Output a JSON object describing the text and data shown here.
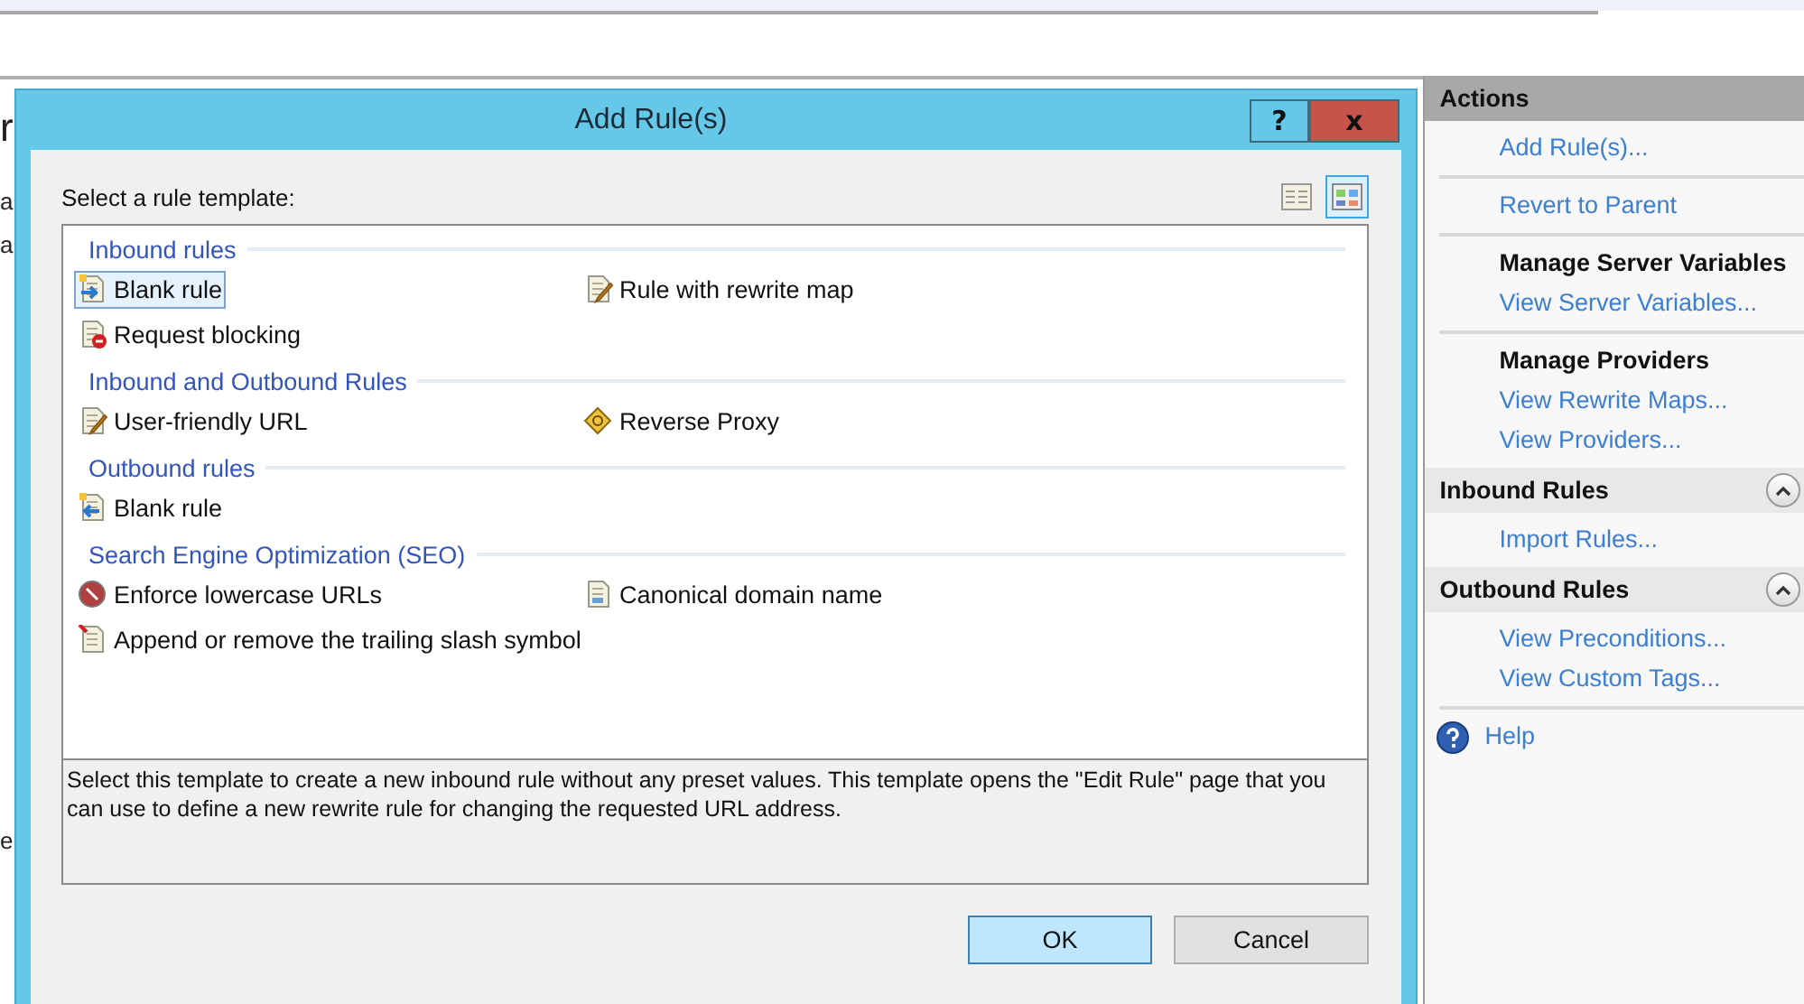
{
  "background": {
    "fragments": [
      {
        "text": "r",
        "kind": "title"
      },
      {
        "text": "a",
        "kind": "line"
      },
      {
        "text": "a",
        "kind": "line"
      },
      {
        "text": "e",
        "kind": "field"
      }
    ]
  },
  "dialog": {
    "title": "Add Rule(s)",
    "help_button": "?",
    "close_button": "x",
    "prompt": "Select a rule template:",
    "views": [
      {
        "kind": "list",
        "selected": false
      },
      {
        "kind": "tiles",
        "selected": true
      }
    ],
    "groups": [
      {
        "title": "Inbound rules",
        "items": [
          {
            "label": "Blank rule",
            "kind": "arrow-in",
            "selected": true
          },
          {
            "label": "Rule with rewrite map",
            "kind": "edit",
            "selected": false
          },
          {
            "label": "Request blocking",
            "kind": "block",
            "selected": false
          }
        ]
      },
      {
        "title": "Inbound and Outbound Rules",
        "items": [
          {
            "label": "User-friendly URL",
            "kind": "edit",
            "selected": false
          },
          {
            "label": "Reverse Proxy",
            "kind": "proxy",
            "selected": false
          }
        ]
      },
      {
        "title": "Outbound rules",
        "items": [
          {
            "label": "Blank rule",
            "kind": "arrow-out",
            "selected": false
          }
        ]
      },
      {
        "title": "Search Engine Optimization (SEO)",
        "items": [
          {
            "label": "Enforce lowercase URLs",
            "kind": "lowercase",
            "selected": false
          },
          {
            "label": "Canonical domain name",
            "kind": "canonical",
            "selected": false
          },
          {
            "label": "Append or remove the trailing slash symbol",
            "kind": "slash",
            "selected": false
          }
        ]
      }
    ],
    "description": "Select this template to create a new inbound rule without any preset values. This template opens the \"Edit Rule\" page that you can use to define a new rewrite rule for changing the requested URL address.",
    "buttons": [
      {
        "label": "OK",
        "kind": "default"
      },
      {
        "label": "Cancel",
        "kind": "normal"
      }
    ]
  },
  "actions_panel": {
    "sections": [
      {
        "title": "Actions",
        "kind": "panel-title",
        "groups": [
          {
            "links": [
              "Add Rule(s)..."
            ]
          },
          {
            "links": [
              "Revert to Parent"
            ]
          },
          {
            "heading": "Manage Server Variables",
            "links": [
              "View Server Variables..."
            ]
          },
          {
            "heading": "Manage Providers",
            "links": [
              "View Rewrite Maps...",
              "View Providers..."
            ]
          }
        ]
      },
      {
        "title": "Inbound Rules",
        "kind": "section",
        "groups": [
          {
            "links": [
              "Import Rules..."
            ]
          }
        ]
      },
      {
        "title": "Outbound Rules",
        "kind": "section",
        "groups": [
          {
            "links": [
              "View Preconditions...",
              "View Custom Tags..."
            ]
          }
        ]
      }
    ],
    "help": "Help"
  }
}
